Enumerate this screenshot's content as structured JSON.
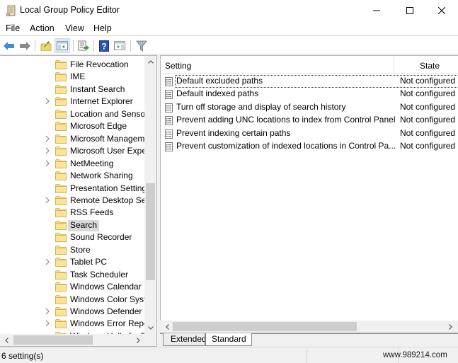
{
  "window": {
    "title": "Local Group Policy Editor",
    "minimize_label": "Minimize",
    "maximize_label": "Maximize",
    "close_label": "Close"
  },
  "menu": [
    "File",
    "Action",
    "View",
    "Help"
  ],
  "toolbar": {
    "buttons": [
      {
        "name": "back-button",
        "icon": "back-arrow-icon"
      },
      {
        "name": "forward-button",
        "icon": "forward-arrow-icon"
      },
      {
        "name": "up-one-level-button",
        "icon": "folder-up-icon"
      },
      {
        "name": "show-hide-console-tree-button",
        "icon": "console-tree-icon",
        "active": true
      },
      {
        "name": "export-list-button",
        "icon": "export-list-icon"
      },
      {
        "name": "help-button",
        "icon": "help-icon"
      },
      {
        "name": "show-hide-action-pane-button",
        "icon": "action-pane-icon"
      },
      {
        "name": "filter-button",
        "icon": "filter-icon"
      }
    ]
  },
  "tree": {
    "items": [
      {
        "label": "File Revocation",
        "expandable": false
      },
      {
        "label": "IME",
        "expandable": false
      },
      {
        "label": "Instant Search",
        "expandable": false
      },
      {
        "label": "Internet Explorer",
        "expandable": true
      },
      {
        "label": "Location and Sensor",
        "expandable": false
      },
      {
        "label": "Microsoft Edge",
        "expandable": false
      },
      {
        "label": "Microsoft Managem",
        "expandable": true
      },
      {
        "label": "Microsoft User Exper",
        "expandable": true
      },
      {
        "label": "NetMeeting",
        "expandable": true
      },
      {
        "label": "Network Sharing",
        "expandable": false
      },
      {
        "label": "Presentation Setting",
        "expandable": false
      },
      {
        "label": "Remote Desktop Ser",
        "expandable": true
      },
      {
        "label": "RSS Feeds",
        "expandable": false
      },
      {
        "label": "Search",
        "expandable": false,
        "selected": true
      },
      {
        "label": "Sound Recorder",
        "expandable": false
      },
      {
        "label": "Store",
        "expandable": false
      },
      {
        "label": "Tablet PC",
        "expandable": true
      },
      {
        "label": "Task Scheduler",
        "expandable": false
      },
      {
        "label": "Windows Calendar",
        "expandable": false
      },
      {
        "label": "Windows Color Syste",
        "expandable": false
      },
      {
        "label": "Windows Defender S",
        "expandable": true
      },
      {
        "label": "Windows Error Repo",
        "expandable": true
      },
      {
        "label": "Windows Hello for B",
        "expandable": false
      }
    ]
  },
  "list": {
    "columns": {
      "setting": "Setting",
      "state": "State"
    },
    "rows": [
      {
        "name": "Default excluded paths",
        "state": "Not configured",
        "focused": true
      },
      {
        "name": "Default indexed paths",
        "state": "Not configured"
      },
      {
        "name": "Turn off storage and display of search history",
        "state": "Not configured"
      },
      {
        "name": "Prevent adding UNC locations to index from Control Panel",
        "state": "Not configured"
      },
      {
        "name": "Prevent indexing certain paths",
        "state": "Not configured"
      },
      {
        "name": "Prevent customization of indexed locations in Control Pa...",
        "state": "Not configured"
      }
    ]
  },
  "tabs": {
    "extended": "Extended",
    "standard": "Standard",
    "active": "Standard"
  },
  "status": {
    "text": "6 setting(s)",
    "watermark": "www.989214.com"
  }
}
